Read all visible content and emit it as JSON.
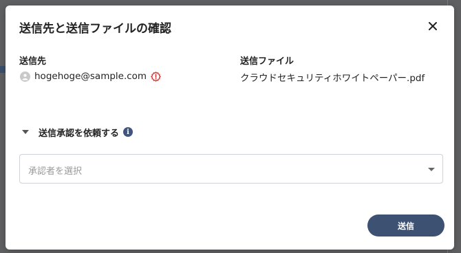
{
  "dialog": {
    "title": "送信先と送信ファイルの確認"
  },
  "recipients": {
    "label": "送信先",
    "items": [
      {
        "email": "hogehoge@sample.com",
        "avatar_icon": "person-icon",
        "status_icon": "warning-icon"
      }
    ]
  },
  "files": {
    "label": "送信ファイル",
    "items": [
      {
        "name": "クラウドセキュリティホワイトペーパー.pdf"
      }
    ]
  },
  "approval": {
    "label": "送信承認を依頼する",
    "info_icon_text": "i",
    "select": {
      "placeholder": "承認者を選択"
    }
  },
  "actions": {
    "send_label": "送信"
  },
  "colors": {
    "primary": "#3d5173",
    "warning": "#d9302c",
    "info": "#3f5580",
    "overlay": "#5f6062"
  }
}
